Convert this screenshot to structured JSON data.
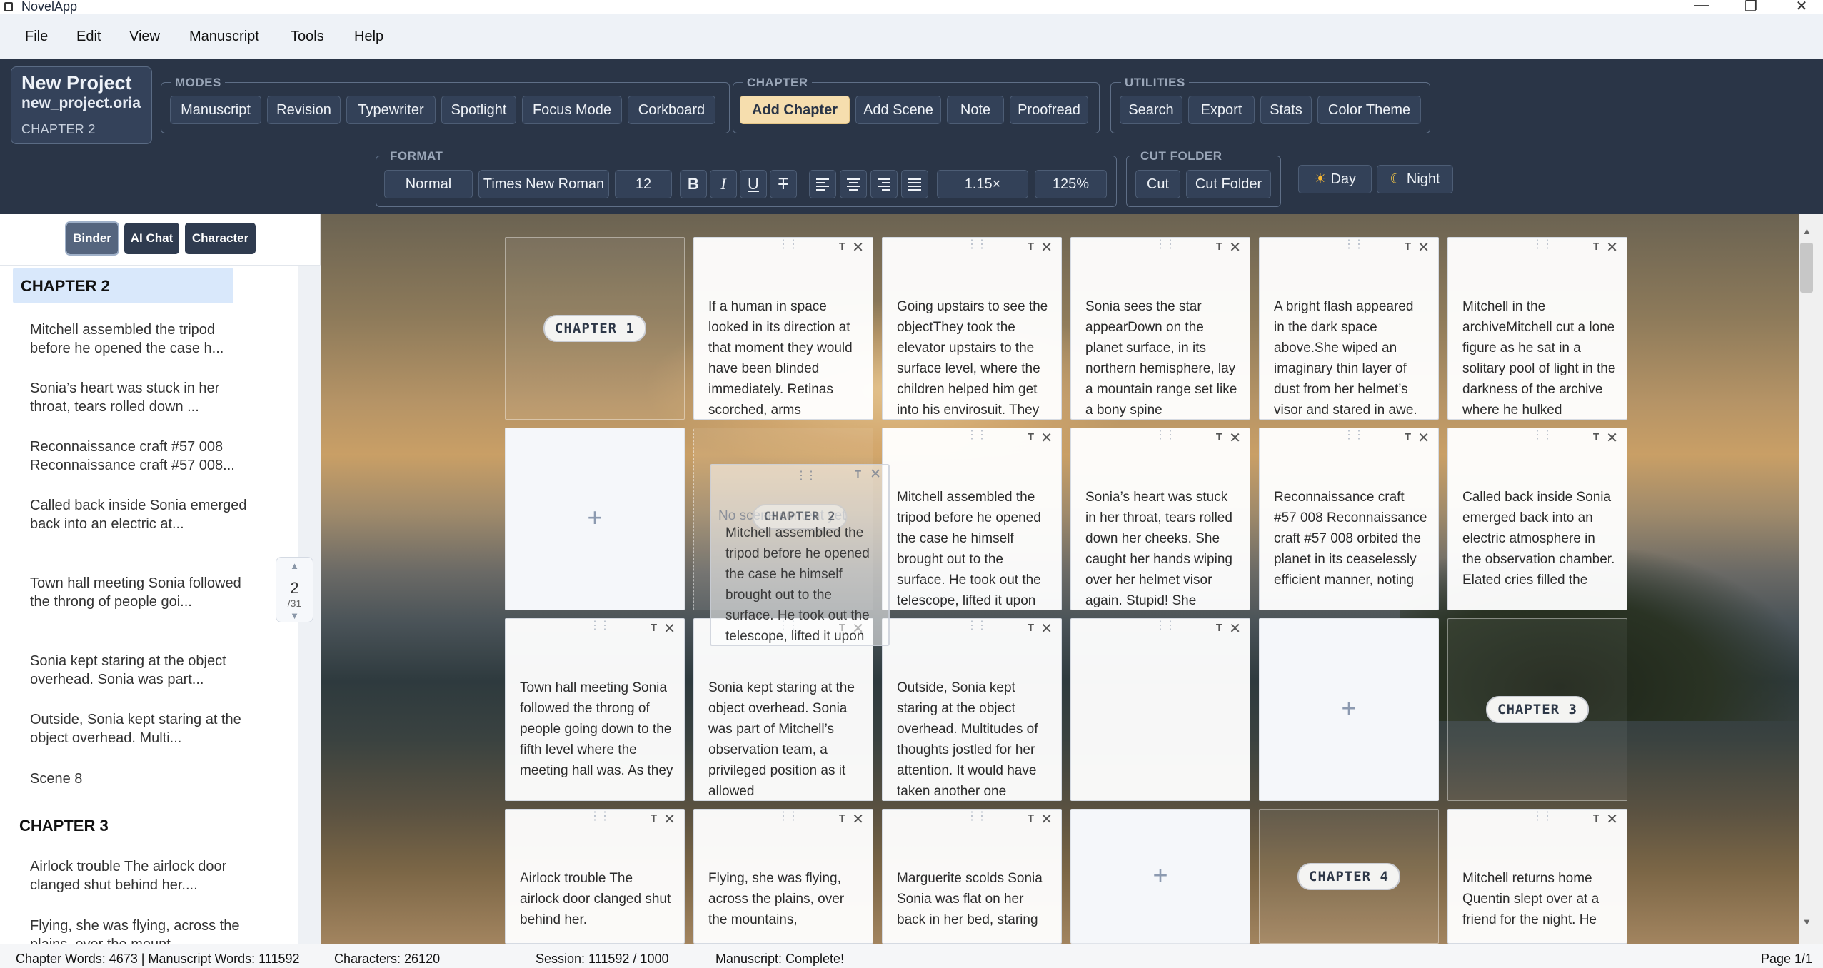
{
  "window": {
    "title": "NovelApp",
    "controls": [
      "—",
      "❐",
      "✕"
    ]
  },
  "menu": [
    "File",
    "Edit",
    "View",
    "Manuscript",
    "Tools",
    "Help"
  ],
  "project": {
    "name": "New Project",
    "file": "new_project.oria",
    "chapter": "CHAPTER 2"
  },
  "modes": {
    "label": "MODES",
    "buttons": [
      "Manuscript",
      "Revision",
      "Typewriter",
      "Spotlight",
      "Focus Mode",
      "Corkboard"
    ]
  },
  "chapter_group": {
    "label": "CHAPTER",
    "buttons": [
      "Add Chapter",
      "Add Scene",
      "Note",
      "Proofread"
    ]
  },
  "utilities": {
    "label": "UTILITIES",
    "buttons": [
      "Search",
      "Export",
      "Stats",
      "Color Theme"
    ]
  },
  "format": {
    "label": "FORMAT",
    "style": "Normal",
    "font": "Times New Roman",
    "size": "12",
    "bold": "B",
    "italic": "I",
    "underline": "U",
    "strike": "T",
    "line_spacing": "1.15×",
    "zoom": "125%"
  },
  "cut_folder": {
    "label": "CUT FOLDER",
    "buttons": [
      "Cut",
      "Cut Folder"
    ]
  },
  "theme": {
    "day": "Day",
    "night": "Night",
    "day_icon": "☀",
    "night_icon": "☾"
  },
  "sidebar": {
    "tabs": [
      "Binder",
      "AI Chat",
      "Character"
    ],
    "active_tab": "Binder",
    "items": [
      {
        "type": "chapter",
        "label": "CHAPTER 2",
        "active": true
      },
      {
        "type": "scene",
        "label": "Mitchell assembled the tripod before he opened the case h..."
      },
      {
        "type": "scene",
        "label": "Sonia’s heart was stuck in her throat, tears rolled down ..."
      },
      {
        "type": "scene",
        "label": "Reconnaissance craft #57 008 Reconnaissance craft #57 008..."
      },
      {
        "type": "scene",
        "label": "Called back inside Sonia emerged back into an electric at..."
      },
      {
        "type": "scene",
        "label": "Town hall meeting Sonia followed the throng of people goi..."
      },
      {
        "type": "scene",
        "label": "Sonia kept staring at the object overhead. Sonia was part..."
      },
      {
        "type": "scene",
        "label": "Outside, Sonia kept staring at the object overhead. Multi..."
      },
      {
        "type": "scene",
        "label": "Scene 8"
      },
      {
        "type": "chapter",
        "label": "CHAPTER 3"
      },
      {
        "type": "scene",
        "label": "Airlock trouble The airlock door clanged shut behind her...."
      },
      {
        "type": "scene",
        "label": "Flying, she was flying, across the plains, over the mount..."
      }
    ],
    "pager": {
      "current": "2",
      "total": "/31"
    }
  },
  "corkboard": {
    "cards": [
      {
        "kind": "chapter",
        "label": "CHAPTER 1"
      },
      {
        "kind": "scene",
        "text": "If a human in space looked in its direction at that moment they would have been blinded immediately. Retinas scorched, arms"
      },
      {
        "kind": "scene",
        "text": "Going upstairs to see the objectThey took the elevator upstairs to the surface level, where the children helped him get into his envirosuit. They"
      },
      {
        "kind": "scene",
        "text": "Sonia sees the star appearDown on the planet surface, in its northern hemisphere, lay a mountain range set like a bony spine"
      },
      {
        "kind": "scene",
        "text": "A bright flash appeared in the dark space above.She wiped an imaginary thin layer of dust from her helmet’s visor and stared in awe."
      },
      {
        "kind": "scene",
        "text": "Mitchell in the archiveMitchell cut a lone figure as he sat in a solitary pool of light in the darkness of the archive where he hulked"
      },
      {
        "kind": "add"
      },
      {
        "kind": "drop"
      },
      {
        "kind": "scene",
        "text": "Mitchell assembled the tripod before he opened the case he himself brought out to the surface. He took out the telescope, lifted it upon"
      },
      {
        "kind": "scene",
        "text": "Sonia’s heart was stuck in her throat, tears rolled down her cheeks. She caught her hands wiping over her helmet visor again. Stupid! She"
      },
      {
        "kind": "scene",
        "text": "Reconnaissance craft #57 008 Reconnaissance craft #57 008 orbited the planet in its ceaselessly efficient manner, noting"
      },
      {
        "kind": "scene",
        "text": "Called back inside Sonia emerged back into an electric atmosphere in the observation chamber. Elated cries filled the"
      },
      {
        "kind": "scene",
        "text": "Town hall meeting Sonia followed the throng of people going down to the fifth level where the meeting hall was. As they"
      },
      {
        "kind": "scene",
        "text": "Sonia kept staring at the object overhead. Sonia was part of Mitchell’s observation team, a privileged position as it allowed"
      },
      {
        "kind": "scene",
        "text": "Outside, Sonia kept staring at the object overhead. Multitudes of thoughts jostled for her attention. It would have taken another one"
      },
      {
        "kind": "scene",
        "text": ""
      },
      {
        "kind": "add"
      },
      {
        "kind": "chapter",
        "label": "CHAPTER 3"
      },
      {
        "kind": "scene",
        "text": "Airlock trouble The airlock door clanged shut behind her."
      },
      {
        "kind": "scene",
        "text": "Flying, she was flying, across the plains, over the mountains,"
      },
      {
        "kind": "scene",
        "text": "Marguerite scolds Sonia Sonia was flat on her back in her bed, staring"
      },
      {
        "kind": "add"
      },
      {
        "kind": "chapter",
        "label": "CHAPTER 4"
      },
      {
        "kind": "scene",
        "text": "Mitchell returns home Quentin slept over at a friend for the night. He"
      }
    ],
    "drag_ghost": {
      "behind": "No scene content yet",
      "label": "CHAPTER 2",
      "text": "Mitchell assembled the tripod before he opened the case he himself brought out to the surface. He took out the telescope, lifted it upon"
    },
    "icons": {
      "drag": "⋮⋮",
      "text": "T",
      "close": "✕",
      "add": "+"
    }
  },
  "status": {
    "words": "Chapter Words: 4673 | Manuscript Words: 111592",
    "chars": "Characters: 26120",
    "session": "Session: 111592 / 1000",
    "state": "Manuscript: Complete!",
    "page": "Page 1/1"
  },
  "colors": {
    "toolbar": "#2a3547",
    "accent": "#f6deae",
    "binder_active": "#d9e8fb"
  }
}
